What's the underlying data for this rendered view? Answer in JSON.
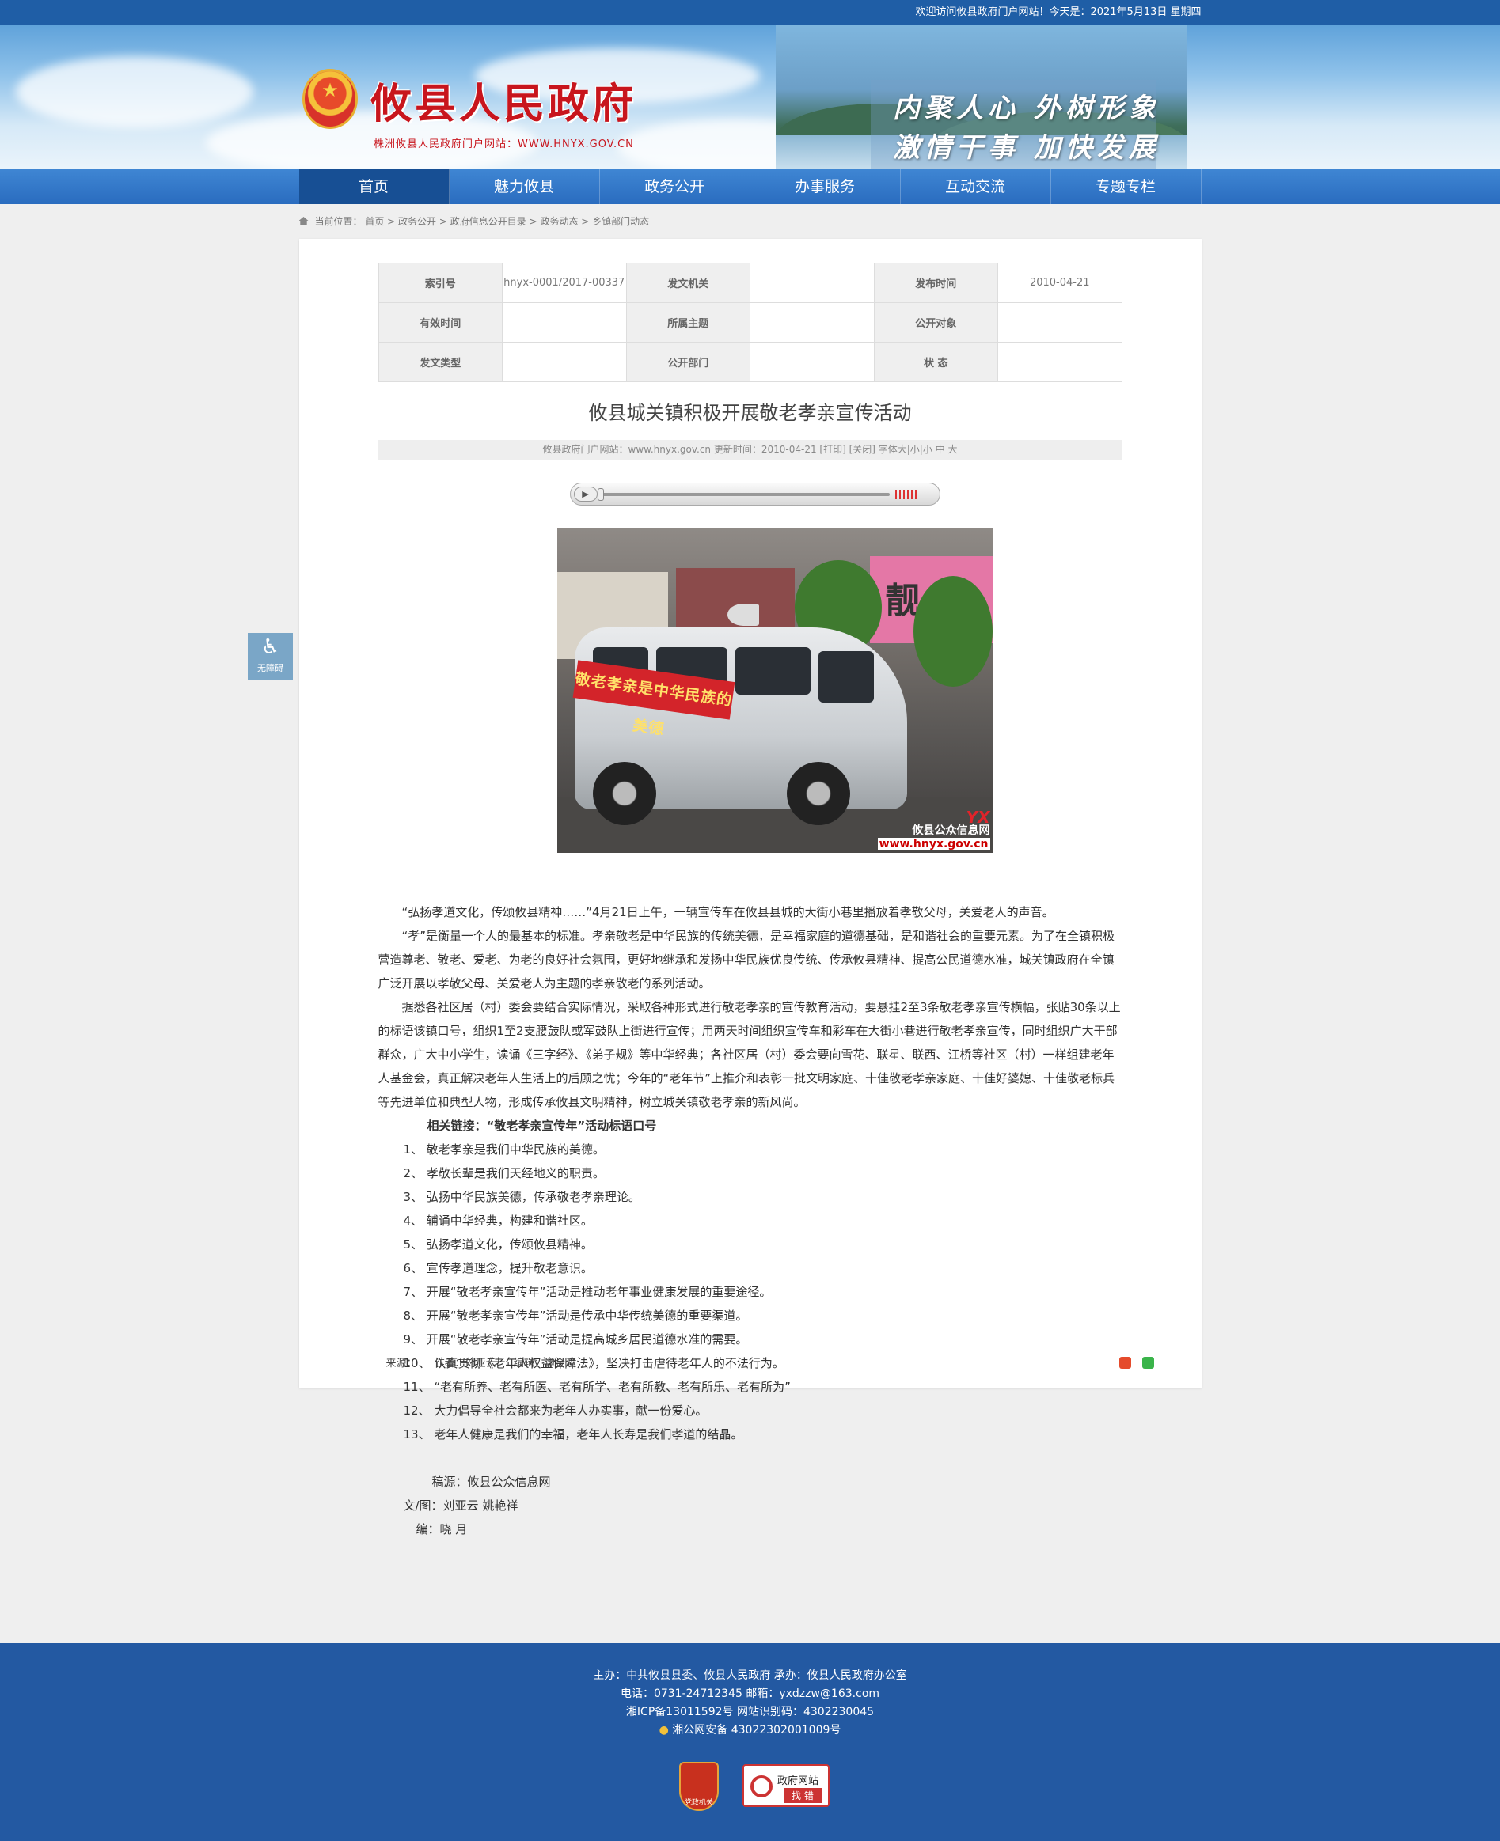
{
  "topbar": {
    "welcome": "欢迎访问攸县政府门户网站！今天是：2021年5月13日 星期四"
  },
  "header": {
    "title": "攸县人民政府",
    "subtitle": "株洲攸县人民政府门户网站：WWW.HNYX.GOV.CN",
    "slogan1": "内聚人心 外树形象",
    "slogan2": "激情干事 加快发展"
  },
  "nav": [
    "首页",
    "魅力攸县",
    "政务公开",
    "办事服务",
    "互动交流",
    "专题专栏"
  ],
  "breadcrumb": {
    "label": "当前位置：",
    "path": [
      "首页",
      "政务公开",
      "政府信息公开目录",
      "政务动态",
      "乡镇部门动态"
    ]
  },
  "meta_table": [
    [
      {
        "k": "索引号"
      },
      {
        "v": "hnyx-0001/2017-00337"
      },
      {
        "k": "发文机关"
      },
      {
        "v": ""
      },
      {
        "k": "发布时间"
      },
      {
        "v": "2010-04-21"
      }
    ],
    [
      {
        "k": "有效时间"
      },
      {
        "v": ""
      },
      {
        "k": "所属主题"
      },
      {
        "v": ""
      },
      {
        "k": "公开对象"
      },
      {
        "v": ""
      }
    ],
    [
      {
        "k": "发文类型"
      },
      {
        "v": ""
      },
      {
        "k": "公开部门"
      },
      {
        "v": ""
      },
      {
        "k": "状 态"
      },
      {
        "v": ""
      }
    ]
  ],
  "article": {
    "title": "攸县城关镇积极开展敬老孝亲宣传活动",
    "info": "攸县政府门户网站：www.hnyx.gov.cn   更新时间：2010-04-21   [打印] [关闭]   字体大|小|小 中 大",
    "photo": {
      "shop_sign": "靓人",
      "banner_text": "敬老孝亲是中华民族的美德",
      "watermark_name": "攸县公众信息网",
      "watermark_url": "www.hnyx.gov.cn"
    },
    "paragraphs": [
      "“弘扬孝道文化，传颂攸县精神……”4月21日上午，一辆宣传车在攸县县城的大街小巷里播放着孝敬父母，关爱老人的声音。",
      "“孝”是衡量一个人的最基本的标准。孝亲敬老是中华民族的传统美德，是幸福家庭的道德基础，是和谐社会的重要元素。为了在全镇积极营造尊老、敬老、爱老、为老的良好社会氛围，更好地继承和发扬中华民族优良传统、传承攸县精神、提高公民道德水准，城关镇政府在全镇广泛开展以孝敬父母、关爱老人为主题的孝亲敬老的系列活动。",
      "据悉各社区居（村）委会要结合实际情况，采取各种形式进行敬老孝亲的宣传教育活动，要悬挂2至3条敬老孝亲宣传横幅，张贴30条以上的标语该镇口号，组织1至2支腰鼓队或军鼓队上街进行宣传；用两天时间组织宣传车和彩车在大街小巷进行敬老孝亲宣传，同时组织广大干部群众，广大中小学生，读诵《三字经》、《弟子规》等中华经典；各社区居（村）委会要向雪花、联星、联西、江桥等社区（村）一样组建老年人基金会，真正解决老年人生活上的后顾之忧；今年的“老年节”上推介和表彰一批文明家庭、十佳敬老孝亲家庭、十佳好婆媳、十佳敬老标兵等先进单位和典型人物，形成传承攸县文明精神，树立城关镇敬老孝亲的新风尚。"
    ],
    "link_title": "相关链接：“敬老孝亲宣传年”活动标语口号",
    "slogans": [
      "1、 敬老孝亲是我们中华民族的美德。",
      "2、 孝敬长辈是我们天经地义的职责。",
      "3、 弘扬中华民族美德，传承敬老孝亲理论。",
      "4、 辅诵中华经典，构建和谐社区。",
      "5、 弘扬孝道文化，传颂攸县精神。",
      "6、 宣传孝道理念，提升敬老意识。",
      "7、 开展“敬老孝亲宣传年”活动是推动老年事业健康发展的重要途径。",
      "8、 开展“敬老孝亲宣传年”活动是传承中华传统美德的重要渠道。",
      "9、 开展“敬老孝亲宣传年”活动是提高城乡居民道德水准的需要。",
      "10、 认真贯彻《老年人权益保障法》，坚决打击虐待老年人的不法行为。",
      "11、 “老有所养、老有所医、老有所学、老有所教、老有所乐、老有所为”",
      "12、 大力倡导全社会都来为老年人办实事，献一份爱心。",
      "13、 老年人健康是我们的幸福，老年人长寿是我们孝道的结晶。"
    ],
    "sig1": "稿源：攸县公众信息网",
    "sig2": "文/图：刘亚云  姚艳祥",
    "sig3": "编：晓   月",
    "source": "来源：",
    "author": "作者：刘亚云",
    "editor": "编辑：谭金波"
  },
  "accessibility": "无障碍",
  "footer": {
    "line1": "主办：中共攸县县委、攸县人民政府 承办：攸县人民政府办公室",
    "line2": "电话：0731-24712345 邮箱：yxdzzw@163.com",
    "line3": "湘ICP备13011592号    网站识别码：4302230045",
    "line4": "湘公网安备 43022302001009号",
    "badge1": "党政机关",
    "badge2_a": "政府网站",
    "badge2_b": "找 错"
  }
}
